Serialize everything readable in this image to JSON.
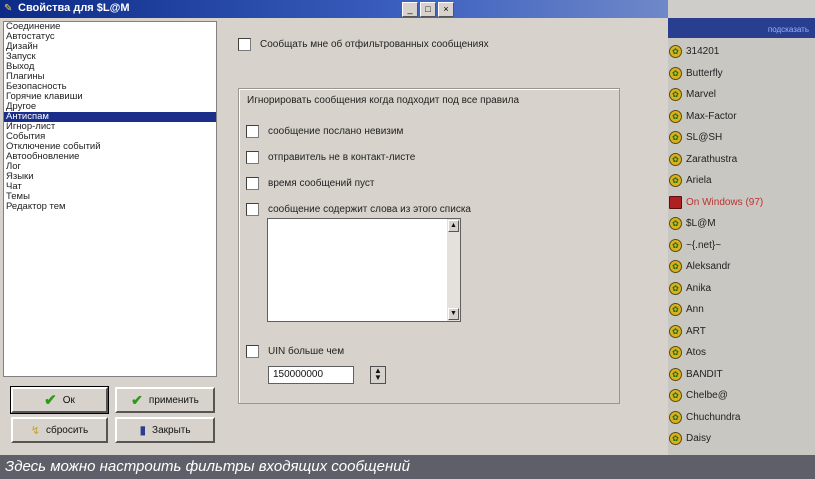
{
  "window": {
    "title": "Свойства для $L@M",
    "minimize": "_",
    "maximize": "□",
    "close": "×"
  },
  "menu": {
    "items": [
      "Соединение",
      "Автостатус",
      "Дизайн",
      "Запуск",
      "Выход",
      "Плагины",
      "Безопасность",
      "Горячие клавиши",
      "Другое",
      "Антиспам",
      "Игнор-лист",
      "События",
      "Отключение событий",
      "Автообновление",
      "Лог",
      "Языки",
      "Чат",
      "Темы",
      "Редактор тем"
    ],
    "selected": 9
  },
  "buttons": {
    "ok": "Ок",
    "apply": "применить",
    "reset": "сбросить",
    "close": "Закрыть"
  },
  "options": {
    "notify_label": "Сообщать мне об отфильтрованных сообщениях",
    "group_title": "Игнорировать сообщения когда подходит под все правила",
    "rules": [
      "сообщение послано невизим",
      "отправитель не в контакт-листе",
      "время сообщений пуст",
      "сообщение содержит слова из этого списка"
    ],
    "uin_label": "UIN больше чем",
    "uin_value": "150000000"
  },
  "contacts": {
    "header": "подсказать",
    "items": [
      {
        "name": "314201",
        "status": "online"
      },
      {
        "name": "Butterfly",
        "status": "online"
      },
      {
        "name": "Marvel",
        "status": "online"
      },
      {
        "name": "Max-Factor",
        "status": "online"
      },
      {
        "name": "SL@SH",
        "status": "online"
      },
      {
        "name": "Zarathustra",
        "status": "online"
      },
      {
        "name": "Ariela",
        "status": "online"
      },
      {
        "name": "On Windows (97)",
        "status": "offline"
      },
      {
        "name": "$L@M",
        "status": "online"
      },
      {
        "name": "~{.net}~",
        "status": "online"
      },
      {
        "name": "Aleksandr",
        "status": "online"
      },
      {
        "name": "Anika",
        "status": "online"
      },
      {
        "name": "Ann",
        "status": "online"
      },
      {
        "name": "ART",
        "status": "online"
      },
      {
        "name": "Atos",
        "status": "online"
      },
      {
        "name": "BANDIT",
        "status": "online"
      },
      {
        "name": "Chelbe@",
        "status": "online"
      },
      {
        "name": "Chuchundra",
        "status": "online"
      },
      {
        "name": "Daisy",
        "status": "online"
      }
    ]
  },
  "caption": "Здесь можно настроить фильтры входящих сообщений",
  "colors": {
    "titlebar": "#0c2a86",
    "selection": "#1b2f8a",
    "caption_bg": "#5e5f68"
  }
}
